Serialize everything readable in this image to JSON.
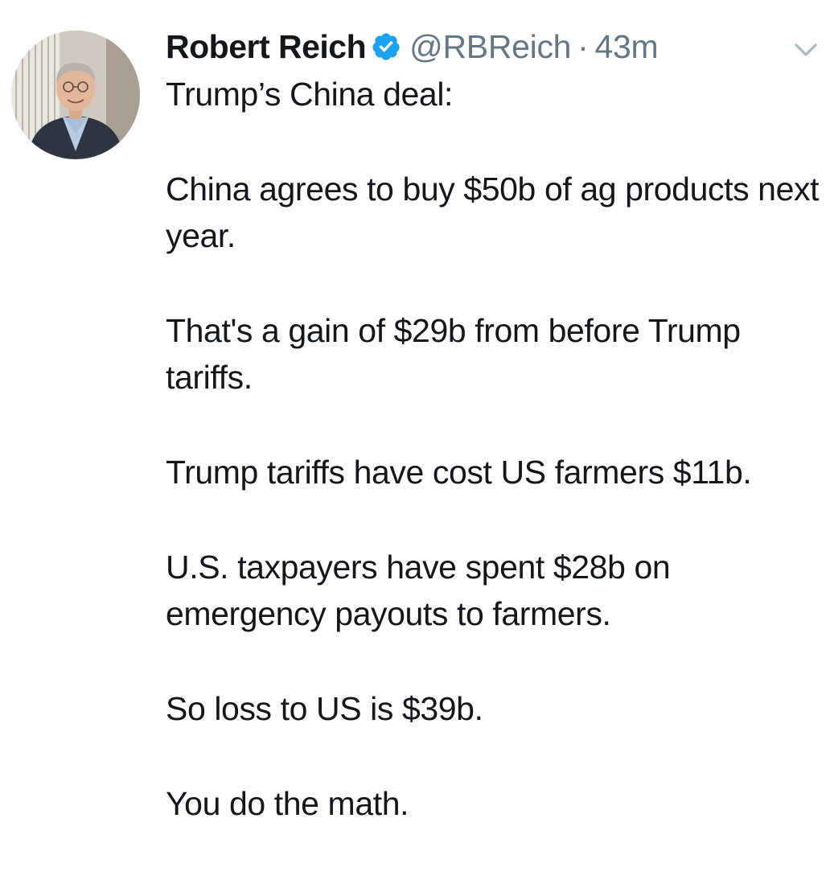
{
  "author": {
    "name": "Robert Reich",
    "handle": "@RBReich",
    "separator": "·",
    "time": "43m",
    "verified": true,
    "verified_color": "#1da1f2"
  },
  "icons": {
    "verified": "verified-badge-icon",
    "menu": "chevron-down-icon"
  },
  "tweet": {
    "paragraphs": [
      "Trump’s China deal:",
      "China agrees to buy $50b of ag products next year.",
      "That's a gain of $29b from before Trump tariffs.",
      "Trump tariffs have cost US farmers $11b.",
      "U.S. taxpayers have spent $28b on emergency payouts to farmers.",
      "So loss to US is $39b.",
      "You do the math."
    ]
  },
  "colors": {
    "text": "#14171a",
    "secondary": "#657786",
    "accent": "#1da1f2"
  }
}
